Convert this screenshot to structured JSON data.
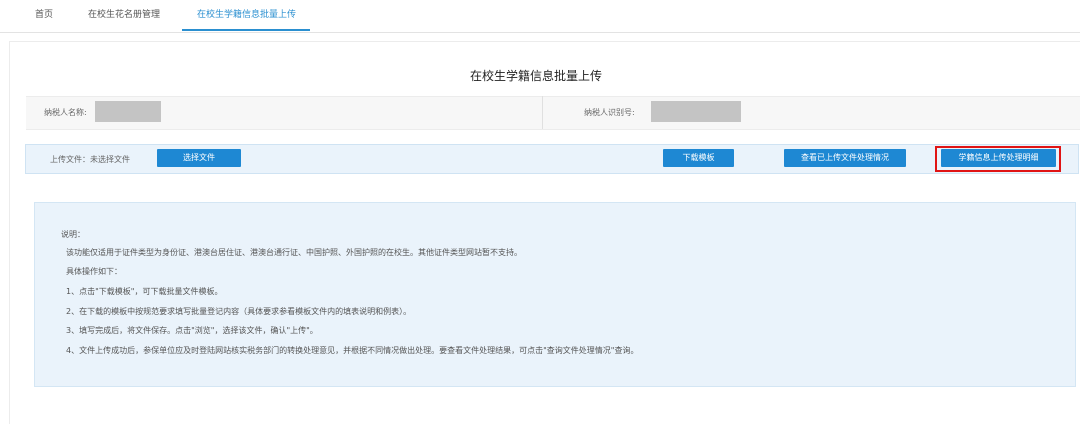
{
  "nav": {
    "tabs": [
      {
        "label": "首页"
      },
      {
        "label": "在校生花名册管理"
      },
      {
        "label": "在校生学籍信息批量上传"
      }
    ]
  },
  "page": {
    "title": "在校生学籍信息批量上传"
  },
  "taxpayer": {
    "name_label": "纳税人名称:",
    "id_label": "纳税人识别号:"
  },
  "upload": {
    "label": "上传文件：未选择文件",
    "choose_file": "选择文件",
    "download_template": "下载模板",
    "view_status": "查看已上传文件处理情况",
    "detail": "学籍信息上传处理明细"
  },
  "notes": {
    "title": "说明：",
    "lines": [
      "该功能仅适用于证件类型为身份证、港澳台居住证、港澳台通行证、中国护照、外国护照的在校生。其他证件类型网站暂不支持。",
      "具体操作如下：",
      "1、点击\"下载模板\"，可下载批量文件模板。",
      "2、在下载的模板中按规范要求填写批量登记内容（具体要求参看模板文件内的填表说明和例表）。",
      "3、填写完成后，将文件保存。点击\"浏览\"，选择该文件，确认\"上传\"。",
      "4、文件上传成功后，参保单位应及时登陆网站核实税务部门的转换处理意见，并根据不同情况做出处理。要查看文件处理结果，可点击\"查询文件处理情况\"查询。"
    ]
  },
  "colors": {
    "accent": "#1e88d3",
    "highlight": "#e01414",
    "note_bg": "#eaf3fb"
  }
}
